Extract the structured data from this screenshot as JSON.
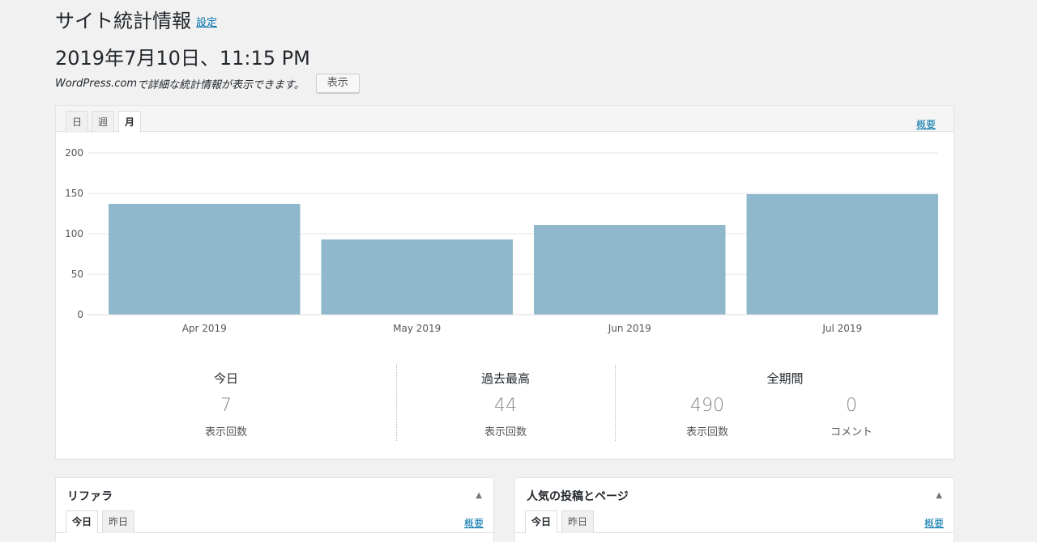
{
  "header": {
    "title": "サイト統計情報",
    "settings_link": "設定"
  },
  "datetime": "2019年7月10日、11:15 PM",
  "promo": {
    "brand": "WordPress.com",
    "text": " で詳細な統計情報が表示できます。",
    "button_label": "表示"
  },
  "main_panel": {
    "tabs": [
      {
        "label": "日",
        "active": false
      },
      {
        "label": "週",
        "active": false
      },
      {
        "label": "月",
        "active": true
      }
    ],
    "summary_link": "概要"
  },
  "chart_data": {
    "type": "bar",
    "categories": [
      "Apr 2019",
      "May 2019",
      "Jun 2019",
      "Jul 2019"
    ],
    "values": [
      137,
      93,
      111,
      149
    ],
    "ylim": [
      0,
      200
    ],
    "yticks": [
      0,
      50,
      100,
      150,
      200
    ],
    "grid": true,
    "bar_color": "#8fb8cc"
  },
  "stats": {
    "today": {
      "label": "今日",
      "value": "7",
      "sub": "表示回数"
    },
    "best": {
      "label": "過去最高",
      "value": "44",
      "sub": "表示回数"
    },
    "all_time": {
      "label": "全期間",
      "views": "490",
      "views_sub": "表示回数",
      "comments": "0",
      "comments_sub": "コメント"
    }
  },
  "widgets": {
    "referrers": {
      "title": "リファラ",
      "tabs": [
        "今日",
        "昨日"
      ],
      "summary_link": "概要"
    },
    "popular": {
      "title": "人気の投稿とページ",
      "tabs": [
        "今日",
        "昨日"
      ],
      "summary_link": "概要"
    }
  },
  "colors": {
    "link": "#0073aa",
    "bar": "#8fb8cc"
  }
}
